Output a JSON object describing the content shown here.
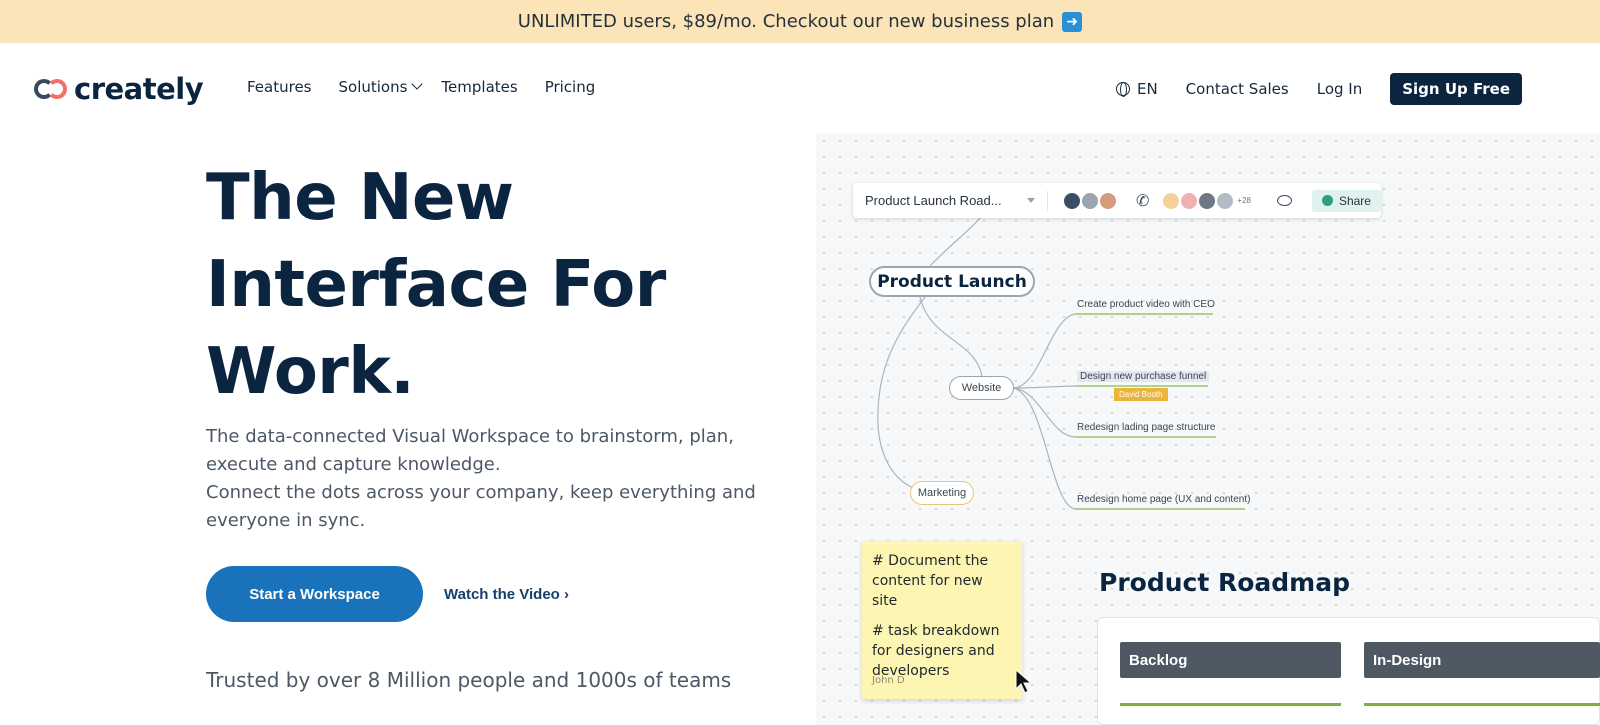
{
  "banner": {
    "text": "UNLIMITED users, $89/mo. Checkout our new business plan",
    "arrow_icon": "right-arrow-icon"
  },
  "nav": {
    "logo_text": "creately",
    "links": [
      "Features",
      "Solutions",
      "Templates",
      "Pricing"
    ],
    "language": "EN",
    "contact": "Contact Sales",
    "login": "Log In",
    "signup": "Sign Up Free"
  },
  "hero": {
    "title_lines": [
      "The New",
      "Interface For",
      "Work."
    ],
    "desc1": "The data-connected Visual Workspace to brainstorm, plan, execute and capture knowledge.",
    "desc2": "Connect the dots across your company, keep everything and everyone in sync.",
    "cta": "Start a Workspace",
    "watch": "Watch the Video",
    "trusted": "Trusted by over 8 Million people and 1000s of teams"
  },
  "preview": {
    "toolbar": {
      "title": "Product Launch Road...",
      "extra_count": "+28",
      "share": "Share"
    },
    "mindmap": {
      "root": "Product Launch",
      "website": "Website",
      "marketing": "Marketing",
      "leaves": [
        "Create product video with CEO",
        "Design new purchase funnel",
        "Redesign lading page structure",
        "Redesign home page (UX and content)"
      ],
      "tag": "David Booth"
    },
    "sticky": {
      "line1": "# Document the content for new site",
      "line2": "# task breakdown for designers and developers",
      "author": "John D"
    },
    "roadmap": {
      "title": "Product Roadmap",
      "columns": [
        "Backlog",
        "In-Design"
      ]
    }
  },
  "colors": {
    "banner_bg": "#fbe5b8",
    "primary": "#1a73ba",
    "navy": "#0b2540",
    "sticky": "#fdf6b3",
    "tag": "#e9b53b"
  }
}
